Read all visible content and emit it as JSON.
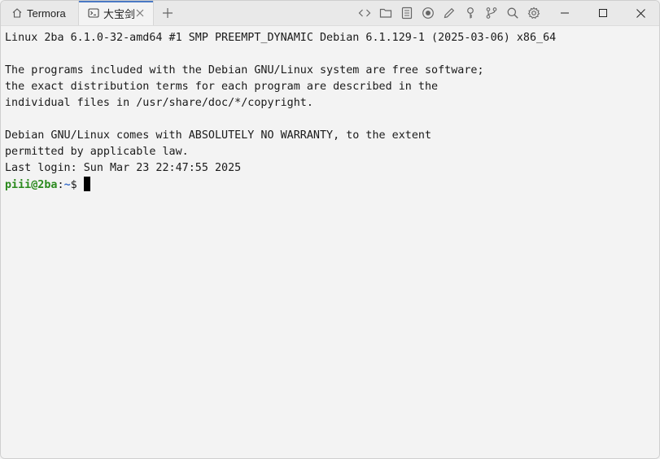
{
  "tabs": [
    {
      "label": "Termora",
      "icon": "home-icon"
    },
    {
      "label": "大宝剑",
      "icon": "terminal-icon",
      "active": true
    }
  ],
  "toolbar": {
    "icons": [
      "code-icon",
      "folder-icon",
      "document-icon",
      "record-icon",
      "pen-icon",
      "key-icon",
      "branch-icon",
      "search-icon",
      "gear-icon"
    ]
  },
  "window_controls": [
    "minimize-icon",
    "maximize-icon",
    "close-icon"
  ],
  "terminal": {
    "lines": [
      "Linux 2ba 6.1.0-32-amd64 #1 SMP PREEMPT_DYNAMIC Debian 6.1.129-1 (2025-03-06) x86_64",
      "",
      "The programs included with the Debian GNU/Linux system are free software;",
      "the exact distribution terms for each program are described in the",
      "individual files in /usr/share/doc/*/copyright.",
      "",
      "Debian GNU/Linux comes with ABSOLUTELY NO WARRANTY, to the extent",
      "permitted by applicable law.",
      "Last login: Sun Mar 23 22:47:55 2025"
    ],
    "prompt": {
      "user_host": "piii@2ba",
      "separator": ":",
      "path": "~",
      "symbol": "$"
    }
  },
  "colors": {
    "prompt_user": "#2b8a1e",
    "prompt_path": "#3a6fcb",
    "active_tab_accent": "#4a79c4",
    "background": "#f3f3f3"
  }
}
